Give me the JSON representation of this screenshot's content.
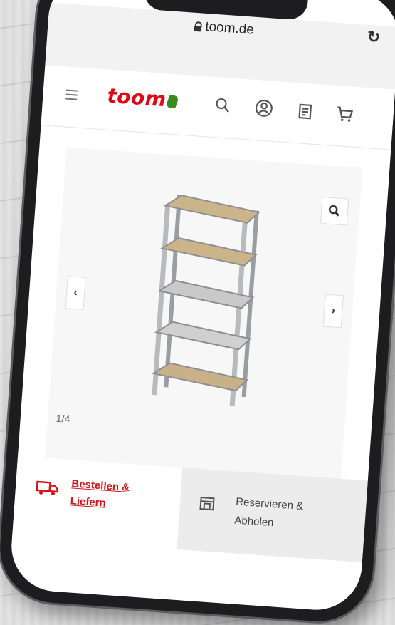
{
  "browser": {
    "url": "toom.de",
    "reload_icon": "reload-icon"
  },
  "header": {
    "logo_text": "toom",
    "icons": [
      "menu-icon",
      "search-icon",
      "account-icon",
      "list-icon",
      "cart-icon"
    ],
    "brand_color": "#e30613"
  },
  "gallery": {
    "counter": "1/4",
    "product": "metal-shelf-image"
  },
  "delivery_tabs": {
    "order_label": "Bestellen & Liefern",
    "pickup_label": "Reservieren & Abholen"
  }
}
